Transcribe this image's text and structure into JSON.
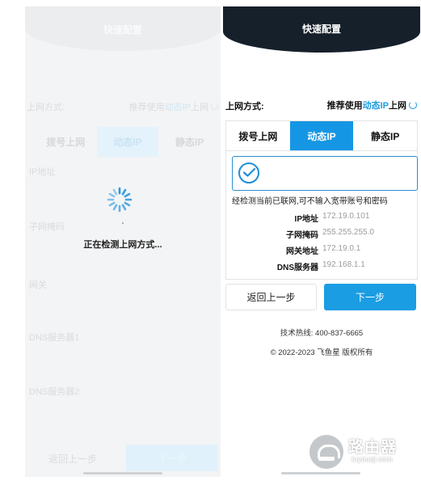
{
  "left_screen": {
    "title": "快速配置",
    "connection_label": "上网方式:",
    "recommend_prefix": "推荐使用",
    "recommend_mode": "动态IP",
    "recommend_suffix": "上网",
    "tabs": [
      "拨号上网",
      "动态IP",
      "静态IP"
    ],
    "field_labels": [
      "IP地址",
      "子网掩码",
      "网关",
      "DNS服务器1",
      "DNS服务器2"
    ],
    "loading_text": "正在检测上网方式...",
    "back_button": "返回上一步",
    "next_button": "下一步"
  },
  "right_screen": {
    "title": "快速配置",
    "connection_label": "上网方式:",
    "recommend_prefix": "推荐使用",
    "recommend_mode": "动态IP",
    "recommend_suffix": "上网",
    "tabs": [
      {
        "label": "拨号上网",
        "active": false
      },
      {
        "label": "动态IP",
        "active": true
      },
      {
        "label": "静态IP",
        "active": false
      }
    ],
    "detect_message": "经检测当前已联网,可不输入宽带账号和密码",
    "fields": [
      {
        "label": "IP地址",
        "value": "172.19.0.101"
      },
      {
        "label": "子网掩码",
        "value": "255.255.255.0"
      },
      {
        "label": "网关地址",
        "value": "172.19.0.1"
      },
      {
        "label": "DNS服务器",
        "value": "192.168.1.1"
      }
    ],
    "back_button": "返回上一步",
    "next_button": "下一步",
    "hotline": "技术热线: 400-837-6665",
    "copyright": "© 2022-2023 飞鱼星 版权所有"
  },
  "watermark": {
    "text_cn": "路由器",
    "text_en": "luyouqi.com"
  },
  "colors": {
    "accent": "#1a9de3",
    "header_dark": "#15202b"
  }
}
